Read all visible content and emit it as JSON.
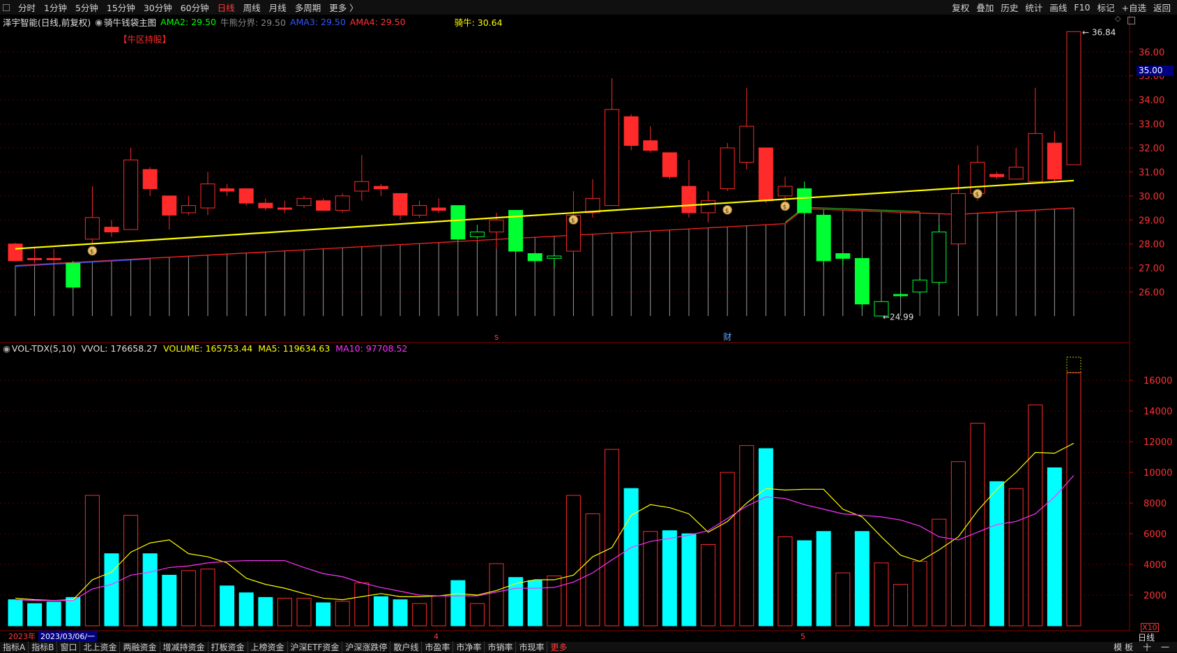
{
  "toolbar": {
    "timeframes": [
      "分时",
      "1分钟",
      "5分钟",
      "15分钟",
      "30分钟",
      "60分钟",
      "日线",
      "周线",
      "月线",
      "多周期",
      "更多 〉"
    ],
    "active": "日线",
    "right_buttons": [
      "复权",
      "叠加",
      "历史",
      "统计",
      "画线",
      "F10",
      "标记",
      "+自选",
      "返回"
    ]
  },
  "title_line": {
    "stock": "泽宇智能(日线,前复权)",
    "indicator": "骑牛钱袋主图",
    "ama2": "AMA2: 29.50",
    "bull_line": "牛熊分界: 29.50",
    "ama3": "AMA3: 29.50",
    "ama4": "AMA4: 29.50",
    "qiniu": "骑牛: 30.64"
  },
  "overlay": {
    "tag": "【牛区持股】",
    "high_label": "36.84",
    "low_label": "24.99",
    "price_tag": "35.00",
    "marker_s": "s",
    "marker_cai": "财"
  },
  "vol_line": {
    "name": "VOL-TDX(5,10)",
    "vvol": "VVOL: 176658.27",
    "volume": "VOLUME: 165753.44",
    "ma5": "MA5: 119634.63",
    "ma10": "MA10: 97708.52"
  },
  "axis": {
    "x10": "X10",
    "daily": "日线",
    "month_4": "4",
    "month_5": "5"
  },
  "datebar": {
    "year": "2023年",
    "cursor": "2023/03/06/一"
  },
  "bottom": {
    "tabs": [
      "指标A",
      "指标B",
      "窗口",
      "北上资金",
      "两融资金",
      "增减持资金",
      "打板资金",
      "上榜资金",
      "沪深ETF资金",
      "沪深涨跌停",
      "散户线",
      "市盈率",
      "市净率",
      "市销率",
      "市现率",
      "更多"
    ],
    "right": [
      "模 板",
      "十",
      "一"
    ]
  },
  "colors": {
    "up": "#ff2b2b",
    "down": "#00ff33",
    "vol_down": "#00ffff",
    "qiniu_line": "#ffff00",
    "ama_red": "#ff2222",
    "ama_blue": "#2255ff",
    "ama_green": "#22aa22",
    "ma5": "#ffff00",
    "ma10": "#ff33ff",
    "ama2_text": "#00ff00",
    "ama3_text": "#3355ff",
    "ama4_text": "#ff3333",
    "qiniu_text": "#ffff00"
  },
  "chart_data": [
    {
      "type": "candlestick",
      "title": "泽宇智能(日线,前复权)",
      "y_ticks": [
        26,
        27,
        28,
        29,
        30,
        31,
        32,
        33,
        34,
        35,
        36
      ],
      "ylim": [
        25,
        36.85
      ],
      "candles": [
        {
          "o": 27.3,
          "c": 28.0,
          "h": 28.05,
          "l": 27.3,
          "dir": "up"
        },
        {
          "o": 27.4,
          "c": 27.4,
          "h": 27.9,
          "l": 27.2,
          "dir": "up"
        },
        {
          "o": 27.4,
          "c": 27.4,
          "h": 27.8,
          "l": 27.0,
          "dir": "up"
        },
        {
          "o": 27.2,
          "c": 26.2,
          "h": 27.3,
          "l": 26.1,
          "dir": "down"
        },
        {
          "o": 28.2,
          "c": 29.1,
          "h": 30.4,
          "l": 28.0,
          "dir": "up_hollow"
        },
        {
          "o": 28.5,
          "c": 28.7,
          "h": 29.0,
          "l": 28.3,
          "dir": "up"
        },
        {
          "o": 28.6,
          "c": 31.5,
          "h": 32.0,
          "l": 28.6,
          "dir": "up_hollow"
        },
        {
          "o": 31.1,
          "c": 30.3,
          "h": 31.2,
          "l": 30.0,
          "dir": "up"
        },
        {
          "o": 30.0,
          "c": 29.2,
          "h": 30.0,
          "l": 28.6,
          "dir": "up"
        },
        {
          "o": 29.6,
          "c": 29.3,
          "h": 30.0,
          "l": 29.2,
          "dir": "up_hollow"
        },
        {
          "o": 29.5,
          "c": 30.5,
          "h": 31.0,
          "l": 29.2,
          "dir": "up_hollow"
        },
        {
          "o": 30.2,
          "c": 30.3,
          "h": 30.5,
          "l": 30.0,
          "dir": "up"
        },
        {
          "o": 30.3,
          "c": 29.7,
          "h": 30.3,
          "l": 29.6,
          "dir": "up"
        },
        {
          "o": 29.5,
          "c": 29.7,
          "h": 29.9,
          "l": 29.4,
          "dir": "up"
        },
        {
          "o": 29.5,
          "c": 29.5,
          "h": 29.8,
          "l": 29.3,
          "dir": "up"
        },
        {
          "o": 29.6,
          "c": 29.9,
          "h": 30.0,
          "l": 29.5,
          "dir": "up_hollow"
        },
        {
          "o": 29.4,
          "c": 29.8,
          "h": 29.9,
          "l": 29.4,
          "dir": "up"
        },
        {
          "o": 29.4,
          "c": 30.0,
          "h": 30.1,
          "l": 29.3,
          "dir": "up_hollow"
        },
        {
          "o": 30.2,
          "c": 30.6,
          "h": 31.7,
          "l": 29.8,
          "dir": "up_hollow"
        },
        {
          "o": 30.3,
          "c": 30.4,
          "h": 30.5,
          "l": 30.0,
          "dir": "up"
        },
        {
          "o": 30.1,
          "c": 29.2,
          "h": 30.1,
          "l": 29.0,
          "dir": "up"
        },
        {
          "o": 29.2,
          "c": 29.6,
          "h": 29.8,
          "l": 29.1,
          "dir": "up_hollow"
        },
        {
          "o": 29.5,
          "c": 29.4,
          "h": 29.9,
          "l": 29.3,
          "dir": "up"
        },
        {
          "o": 29.6,
          "c": 28.2,
          "h": 29.6,
          "l": 28.1,
          "dir": "down"
        },
        {
          "o": 28.5,
          "c": 28.3,
          "h": 28.8,
          "l": 28.2,
          "dir": "down_hollow"
        },
        {
          "o": 28.5,
          "c": 29.0,
          "h": 29.3,
          "l": 27.8,
          "dir": "up_hollow"
        },
        {
          "o": 29.4,
          "c": 27.7,
          "h": 29.4,
          "l": 27.6,
          "dir": "down"
        },
        {
          "o": 27.6,
          "c": 27.3,
          "h": 27.6,
          "l": 27.2,
          "dir": "down"
        },
        {
          "o": 27.5,
          "c": 27.4,
          "h": 27.6,
          "l": 27.0,
          "dir": "down_hollow"
        },
        {
          "o": 27.7,
          "c": 29.2,
          "h": 30.2,
          "l": 27.6,
          "dir": "up_hollow"
        },
        {
          "o": 29.3,
          "c": 29.9,
          "h": 30.7,
          "l": 29.1,
          "dir": "up_hollow"
        },
        {
          "o": 29.6,
          "c": 33.6,
          "h": 34.9,
          "l": 29.6,
          "dir": "up_hollow"
        },
        {
          "o": 33.3,
          "c": 32.1,
          "h": 33.4,
          "l": 31.9,
          "dir": "up"
        },
        {
          "o": 32.3,
          "c": 31.9,
          "h": 32.9,
          "l": 31.8,
          "dir": "up"
        },
        {
          "o": 31.8,
          "c": 30.8,
          "h": 31.8,
          "l": 30.7,
          "dir": "up"
        },
        {
          "o": 30.4,
          "c": 29.3,
          "h": 31.5,
          "l": 29.1,
          "dir": "up"
        },
        {
          "o": 29.8,
          "c": 29.3,
          "h": 30.2,
          "l": 28.9,
          "dir": "up_hollow"
        },
        {
          "o": 30.3,
          "c": 32.0,
          "h": 32.2,
          "l": 30.2,
          "dir": "up_hollow"
        },
        {
          "o": 31.4,
          "c": 32.9,
          "h": 34.5,
          "l": 31.1,
          "dir": "up_hollow"
        },
        {
          "o": 32.0,
          "c": 29.8,
          "h": 32.0,
          "l": 29.7,
          "dir": "up"
        },
        {
          "o": 30.0,
          "c": 30.4,
          "h": 30.8,
          "l": 29.6,
          "dir": "up_hollow"
        },
        {
          "o": 30.3,
          "c": 29.3,
          "h": 30.6,
          "l": 29.2,
          "dir": "down"
        },
        {
          "o": 29.2,
          "c": 27.3,
          "h": 29.3,
          "l": 27.1,
          "dir": "down"
        },
        {
          "o": 27.6,
          "c": 27.4,
          "h": 27.6,
          "l": 27.1,
          "dir": "down"
        },
        {
          "o": 27.4,
          "c": 25.5,
          "h": 27.4,
          "l": 25.3,
          "dir": "down"
        },
        {
          "o": 25.6,
          "c": 25.0,
          "h": 25.6,
          "l": 24.99,
          "dir": "down_hollow"
        },
        {
          "o": 25.9,
          "c": 25.9,
          "h": 26.0,
          "l": 25.8,
          "dir": "down"
        },
        {
          "o": 26.0,
          "c": 26.5,
          "h": 26.6,
          "l": 25.9,
          "dir": "down_hollow"
        },
        {
          "o": 26.4,
          "c": 28.5,
          "h": 28.8,
          "l": 26.3,
          "dir": "down_hollow"
        },
        {
          "o": 28.0,
          "c": 30.1,
          "h": 31.3,
          "l": 28.0,
          "dir": "up_hollow"
        },
        {
          "o": 30.1,
          "c": 31.4,
          "h": 32.1,
          "l": 29.8,
          "dir": "up_hollow"
        },
        {
          "o": 30.8,
          "c": 30.9,
          "h": 31.0,
          "l": 30.7,
          "dir": "up"
        },
        {
          "o": 30.7,
          "c": 31.2,
          "h": 32.0,
          "l": 30.7,
          "dir": "up_hollow"
        },
        {
          "o": 30.6,
          "c": 32.6,
          "h": 34.5,
          "l": 30.6,
          "dir": "up_hollow"
        },
        {
          "o": 32.2,
          "c": 30.7,
          "h": 32.7,
          "l": 30.6,
          "dir": "up"
        },
        {
          "o": 31.3,
          "c": 36.84,
          "h": 36.84,
          "l": 31.3,
          "dir": "up_hollow"
        }
      ],
      "qiniu_line": [
        27.8,
        30.64
      ],
      "bull_markers_index": [
        4,
        29,
        37,
        40,
        50
      ],
      "sell_marker_index": 25,
      "fin_marker_index": 37,
      "high_index": 55,
      "low_index": 45
    },
    {
      "type": "bar",
      "title": "VOL-TDX(5,10)",
      "y_ticks": [
        2000,
        4000,
        6000,
        8000,
        10000,
        12000,
        14000,
        16000
      ],
      "ylim": [
        0,
        17600
      ],
      "unit_label": "X10",
      "volumes": [
        1700,
        1450,
        1550,
        1850,
        8500,
        4700,
        7200,
        4700,
        3300,
        3600,
        3700,
        2600,
        2150,
        1850,
        1800,
        1800,
        1500,
        1600,
        2800,
        1900,
        1700,
        1450,
        1950,
        2950,
        1450,
        4050,
        3150,
        2950,
        3250,
        8500,
        7300,
        11500,
        8950,
        6150,
        6200,
        6000,
        5300,
        10000,
        11750,
        11550,
        5800,
        5550,
        6150,
        3450,
        6150,
        4100,
        2700,
        4200,
        6950,
        10700,
        13200,
        9400,
        8950,
        14400,
        10300,
        16500
      ],
      "vol_colors": [
        "cyan",
        "cyan",
        "cyan",
        "cyan",
        "red",
        "cyan",
        "red",
        "cyan",
        "cyan",
        "red",
        "red",
        "cyan",
        "cyan",
        "cyan",
        "red",
        "red",
        "cyan",
        "red",
        "red",
        "cyan",
        "cyan",
        "red",
        "red",
        "cyan",
        "red",
        "red",
        "cyan",
        "cyan",
        "red",
        "red",
        "red",
        "red",
        "cyan",
        "red",
        "cyan",
        "cyan",
        "red",
        "red",
        "red",
        "cyan",
        "red",
        "cyan",
        "cyan",
        "red",
        "cyan",
        "red",
        "red",
        "red",
        "red",
        "red",
        "red",
        "cyan",
        "red",
        "red",
        "cyan",
        "red"
      ],
      "ma5": [
        1800,
        1700,
        1650,
        1700,
        3000,
        3500,
        4800,
        5400,
        5600,
        4700,
        4500,
        4100,
        3100,
        2700,
        2450,
        2100,
        1800,
        1700,
        1900,
        2100,
        1900,
        1900,
        1950,
        2100,
        2000,
        2300,
        2750,
        3000,
        3000,
        3300,
        4500,
        5100,
        7200,
        7900,
        7700,
        7300,
        6100,
        6800,
        8000,
        8950,
        8850,
        8900,
        8900,
        7600,
        7100,
        5800,
        4600,
        4200,
        4950,
        5800,
        7500,
        8900,
        10000,
        11300,
        11250,
        11900
      ],
      "ma10": [
        1700,
        1650,
        1650,
        1650,
        2400,
        2700,
        3300,
        3500,
        3800,
        3900,
        4100,
        4200,
        4250,
        4250,
        4250,
        3800,
        3400,
        3200,
        2800,
        2500,
        2250,
        2000,
        1950,
        1950,
        1950,
        2200,
        2450,
        2450,
        2500,
        2850,
        3450,
        4300,
        5100,
        5500,
        5700,
        5900,
        6200,
        7000,
        7800,
        8400,
        8300,
        7900,
        7600,
        7300,
        7200,
        7100,
        6900,
        6500,
        5800,
        5600,
        6100,
        6600,
        6800,
        7300,
        8400,
        9800
      ]
    }
  ]
}
